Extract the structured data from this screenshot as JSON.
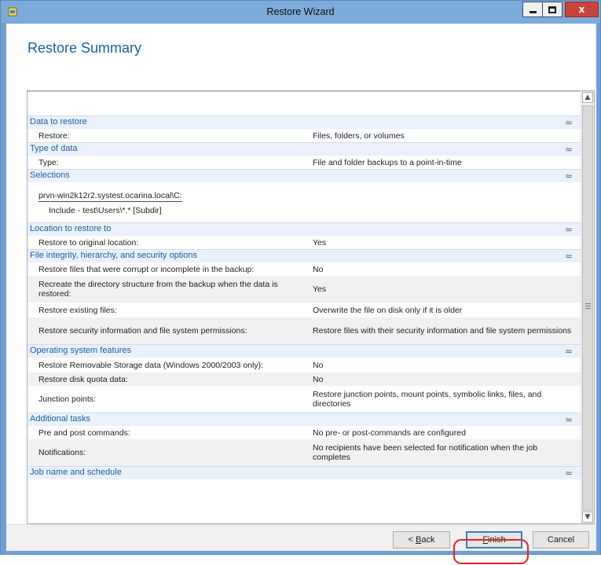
{
  "window": {
    "title": "Restore Wizard",
    "icons": {
      "app": "backup-app-icon",
      "minimize": "minimize-icon",
      "maximize": "maximize-icon",
      "close": "close-icon"
    },
    "close_glyph": "x"
  },
  "page": {
    "title": "Restore Summary"
  },
  "summary": {
    "data_to_restore": {
      "header": "Data to restore",
      "rows": [
        {
          "label": "Restore:",
          "value": "Files, folders, or volumes"
        }
      ]
    },
    "type_of_data": {
      "header": "Type of data",
      "rows": [
        {
          "label": "Type:",
          "value": "File and folder backups to a point-in-time"
        }
      ]
    },
    "selections": {
      "header": "Selections",
      "host": "prvn-win2k12r2.systest.ocarina.local\\C:",
      "include": "Include - test\\Users\\*.* [Subdir]"
    },
    "location": {
      "header": "Location to restore to",
      "rows": [
        {
          "label": "Restore to original location:",
          "value": "Yes"
        }
      ]
    },
    "file_integrity": {
      "header": "File integrity, hierarchy, and security options",
      "rows": [
        {
          "label": "Restore files that were corrupt or incomplete in the backup:",
          "value": "No"
        },
        {
          "label": "Recreate the directory structure from the backup when the data is restored:",
          "value": "Yes"
        },
        {
          "label": "Restore existing files:",
          "value": "Overwrite the file on disk only if it is older"
        },
        {
          "label": "Restore security information and file system permissions:",
          "value": "Restore files with their security information and file system permissions"
        }
      ]
    },
    "os_features": {
      "header": "Operating system features",
      "rows": [
        {
          "label": "Restore Removable Storage data (Windows 2000/2003 only):",
          "value": "No"
        },
        {
          "label": "Restore disk quota data:",
          "value": "No"
        },
        {
          "label": "Junction points:",
          "value": "Restore junction points, mount points, symbolic links, files, and directories"
        }
      ]
    },
    "additional_tasks": {
      "header": "Additional tasks",
      "rows": [
        {
          "label": "Pre and post commands:",
          "value": "No pre- or post-commands are configured"
        },
        {
          "label": "Notifications:",
          "value": "No recipients have been selected for notification when the job completes"
        }
      ]
    },
    "job_name": {
      "header": "Job name and schedule"
    },
    "collapse_glyph": "≈"
  },
  "buttons": {
    "back": {
      "prefix": "< ",
      "accel": "B",
      "rest": "ack"
    },
    "finish": {
      "accel": "F",
      "rest": "inish"
    },
    "cancel": "Cancel"
  },
  "colors": {
    "accent": "#1c5eaa",
    "titlebar": "#7dabd9",
    "highlight": "#e0262a",
    "close": "#c7463b"
  }
}
